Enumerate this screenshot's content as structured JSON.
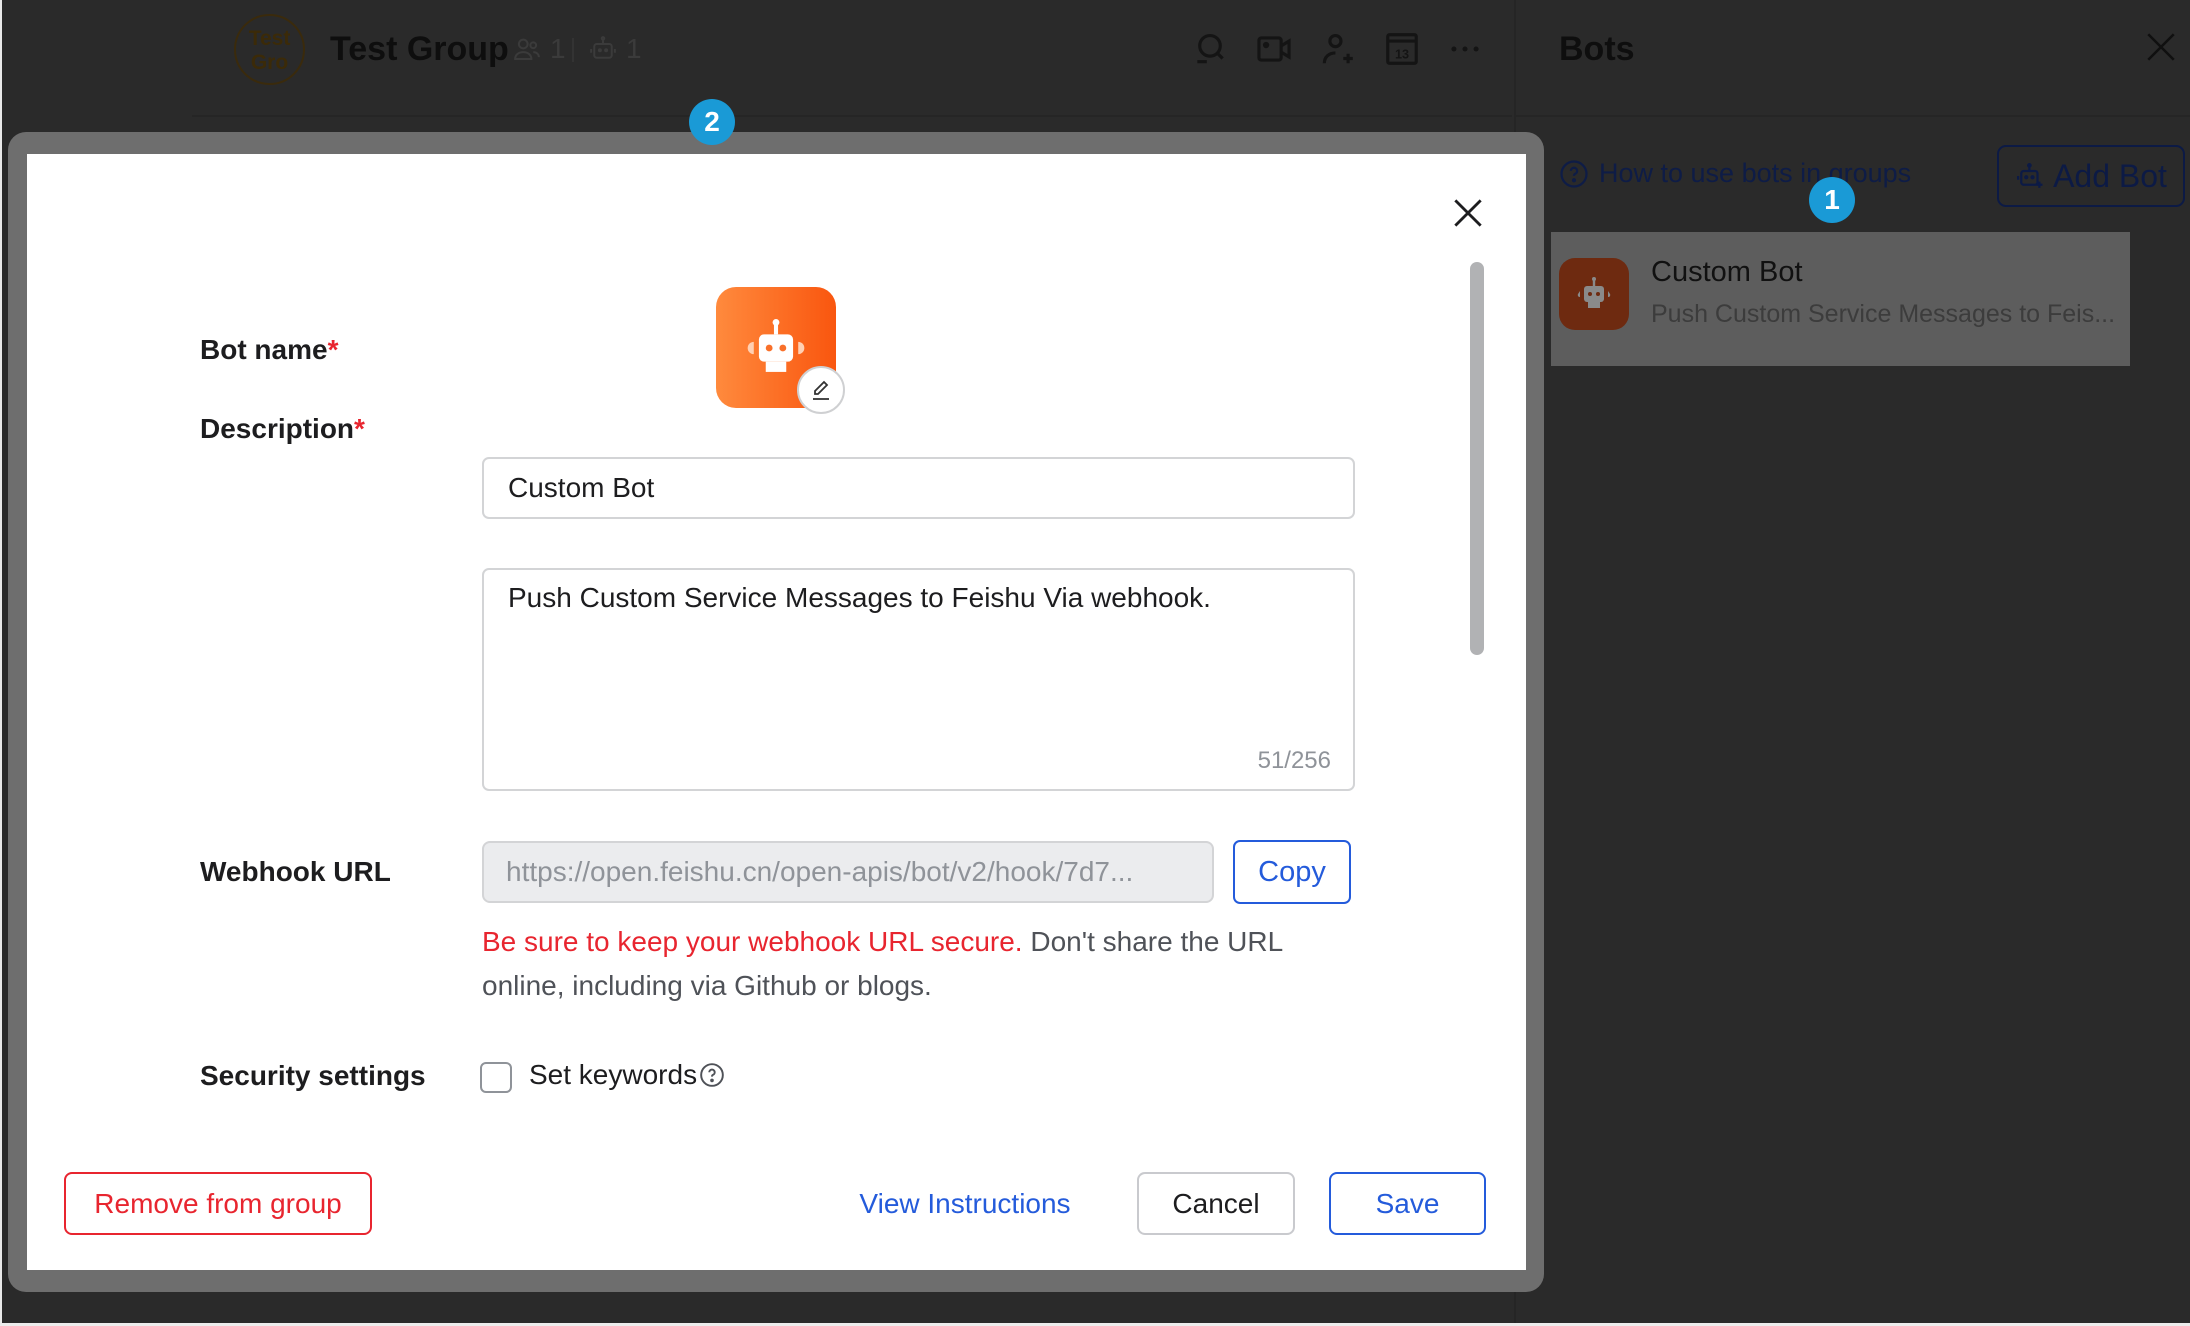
{
  "chat_header": {
    "avatar_text": "Test Gro",
    "title": "Test Group",
    "member_count": "1",
    "bot_count": "1",
    "icons": [
      "search-icon",
      "video-call-icon",
      "add-member-icon",
      "calendar-icon",
      "more-icon"
    ],
    "calendar_day": "13"
  },
  "bots_panel": {
    "title": "Bots",
    "help_link": "How to use bots in groups",
    "add_bot_label": "Add Bot",
    "items": [
      {
        "name": "Custom Bot",
        "description": "Push Custom Service Messages to Feis..."
      }
    ]
  },
  "badges": {
    "one": "1",
    "two": "2"
  },
  "modal": {
    "bot_name_label": "Bot name",
    "bot_name_value": "Custom Bot",
    "description_label": "Description",
    "description_value": "Push Custom Service Messages to Feishu Via webhook.",
    "description_counter": "51/256",
    "required_mark": "*",
    "webhook_label": "Webhook URL",
    "webhook_value": "https://open.feishu.cn/open-apis/bot/v2/hook/7d7...",
    "copy_label": "Copy",
    "warning_red": "Be sure to keep your webhook URL secure.",
    "warning_rest": " Don't share the URL online, including via Github or blogs.",
    "security_label": "Security settings",
    "set_keywords_label": "Set keywords",
    "set_keywords_checked": false,
    "remove_label": "Remove from group",
    "view_instructions_label": "View Instructions",
    "cancel_label": "Cancel",
    "save_label": "Save"
  },
  "colors": {
    "accent_blue": "#245bdb",
    "danger_red": "#e8252f",
    "badge_blue": "#1a9ad6",
    "bot_orange": "#f9560f"
  }
}
